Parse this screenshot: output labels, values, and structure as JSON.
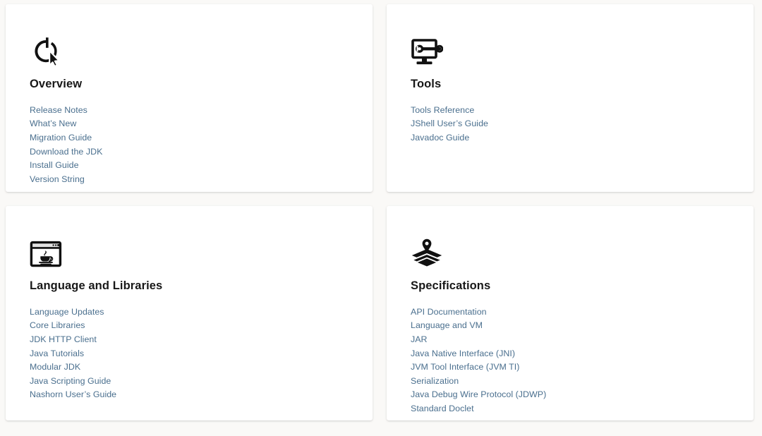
{
  "page": {
    "background_color": "#faf9f7",
    "card_color": "#ffffff",
    "heading_color": "#181818",
    "link_color": "#4a6f8e"
  },
  "cards": [
    {
      "id": "overview",
      "icon": "power-cursor-icon",
      "title": "Overview",
      "links": [
        "Release Notes",
        "What’s New",
        "Migration Guide",
        "Download the JDK",
        "Install Guide",
        "Version String"
      ]
    },
    {
      "id": "tools",
      "icon": "monitor-wrench-icon",
      "title": "Tools",
      "links": [
        "Tools Reference",
        "JShell User’s Guide",
        "Javadoc Guide"
      ]
    },
    {
      "id": "language-and-libraries",
      "icon": "java-window-icon",
      "title": "Language and Libraries",
      "links": [
        "Language Updates",
        "Core Libraries",
        "JDK HTTP Client",
        "Java Tutorials",
        "Modular JDK",
        "Java Scripting Guide",
        "Nashorn User’s Guide"
      ]
    },
    {
      "id": "specifications",
      "icon": "layers-pin-icon",
      "title": "Specifications",
      "links": [
        "API Documentation",
        "Language and VM",
        "JAR",
        "Java Native Interface (JNI)",
        "JVM Tool Interface (JVM TI)",
        "Serialization",
        "Java Debug Wire Protocol (JDWP)",
        "Standard Doclet"
      ]
    }
  ]
}
